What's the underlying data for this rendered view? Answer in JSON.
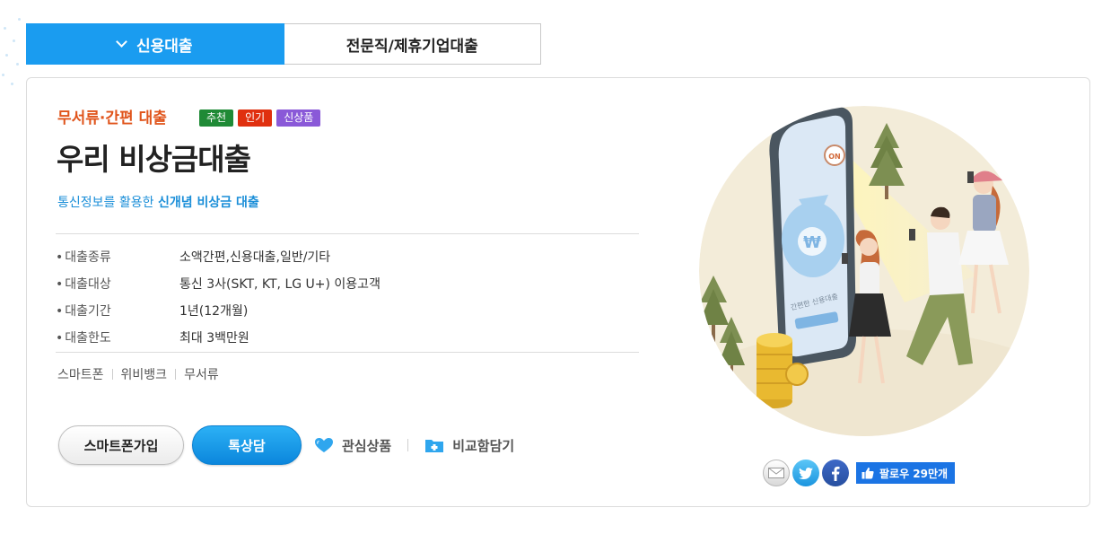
{
  "tabs": [
    {
      "label": "신용대출",
      "active": true
    },
    {
      "label": "전문직/제휴기업대출",
      "active": false
    }
  ],
  "product": {
    "category": "무서류·간편 대출",
    "badges": [
      {
        "label": "추천",
        "color": "#1f8a36"
      },
      {
        "label": "인기",
        "color": "#e0300f"
      },
      {
        "label": "신상품",
        "color": "#8a59d8"
      }
    ],
    "title": "우리 비상금대출",
    "subtitle_prefix": "통신정보를 활용한 ",
    "subtitle_highlight": "신개념 비상금 대출",
    "info": [
      {
        "label": "대출종류",
        "value": "소액간편,신용대출,일반/기타"
      },
      {
        "label": "대출대상",
        "value": "통신 3사(SKT, KT, LG U+) 이용고객"
      },
      {
        "label": "대출기간",
        "value": "1년(12개월)"
      },
      {
        "label": "대출한도",
        "value": "최대 3백만원"
      }
    ],
    "tags": [
      "스마트폰",
      "위비뱅크",
      "무서류"
    ]
  },
  "actions": {
    "smartphone_join": "스마트폰가입",
    "consult": "톡상담",
    "favorite": "관심상품",
    "compare": "비교함담기"
  },
  "share": {
    "icons": [
      "mail-icon",
      "twitter-icon",
      "facebook-icon"
    ],
    "follow_label": "팔로우 29만개"
  },
  "illustration": {
    "phone_on_label": "ON",
    "phone_card_label": "간편한 신용대출",
    "coin_symbol": "₩"
  },
  "colors": {
    "accent_blue": "#1a9cf0",
    "category_orange": "#e0541b",
    "subtitle_blue": "#1a8ed8",
    "facebook": "#1b74e4"
  }
}
